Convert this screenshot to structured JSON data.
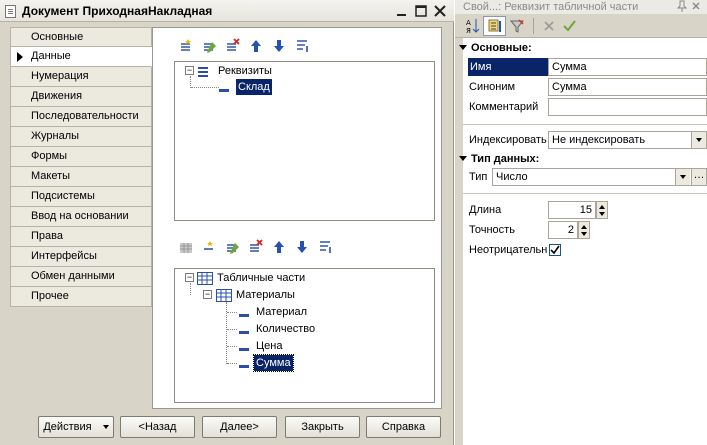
{
  "window": {
    "title": "Документ ПриходнаяНакладная"
  },
  "nav": {
    "items": [
      {
        "label": "Основные"
      },
      {
        "label": "Данные",
        "active": true
      },
      {
        "label": "Нумерация"
      },
      {
        "label": "Движения"
      },
      {
        "label": "Последовательности"
      },
      {
        "label": "Журналы"
      },
      {
        "label": "Формы"
      },
      {
        "label": "Макеты"
      },
      {
        "label": "Подсистемы"
      },
      {
        "label": "Ввод на основании"
      },
      {
        "label": "Права"
      },
      {
        "label": "Интерфейсы"
      },
      {
        "label": "Обмен данными"
      },
      {
        "label": "Прочее"
      }
    ]
  },
  "requisites_tree": {
    "root": "Реквизиты",
    "child": "Склад"
  },
  "tabular_tree": {
    "root": "Табличные части",
    "table": "Материалы",
    "columns": [
      "Материал",
      "Количество",
      "Цена",
      "Сумма"
    ]
  },
  "buttons": {
    "actions": "Действия",
    "back": "<Назад",
    "next": "Далее>",
    "close": "Закрыть",
    "help": "Справка"
  },
  "panel": {
    "title": "Свой...: Реквизит табличной части",
    "section_main": "Основные:",
    "name_label": "Имя",
    "name_value": "Сумма",
    "synonym_label": "Синоним",
    "synonym_value": "Сумма",
    "comment_label": "Комментарий",
    "comment_value": "",
    "indexing_label": "Индексировать",
    "indexing_value": "Не индексировать",
    "section_type": "Тип данных:",
    "type_label": "Тип",
    "type_value": "Число",
    "length_label": "Длина",
    "length_value": "15",
    "precision_label": "Точность",
    "precision_value": "2",
    "nonnegative_label": "Неотрицательн",
    "nonnegative_checked": true
  },
  "colors": {
    "selection": "#0a246a",
    "chrome": "#d8d4c8"
  }
}
